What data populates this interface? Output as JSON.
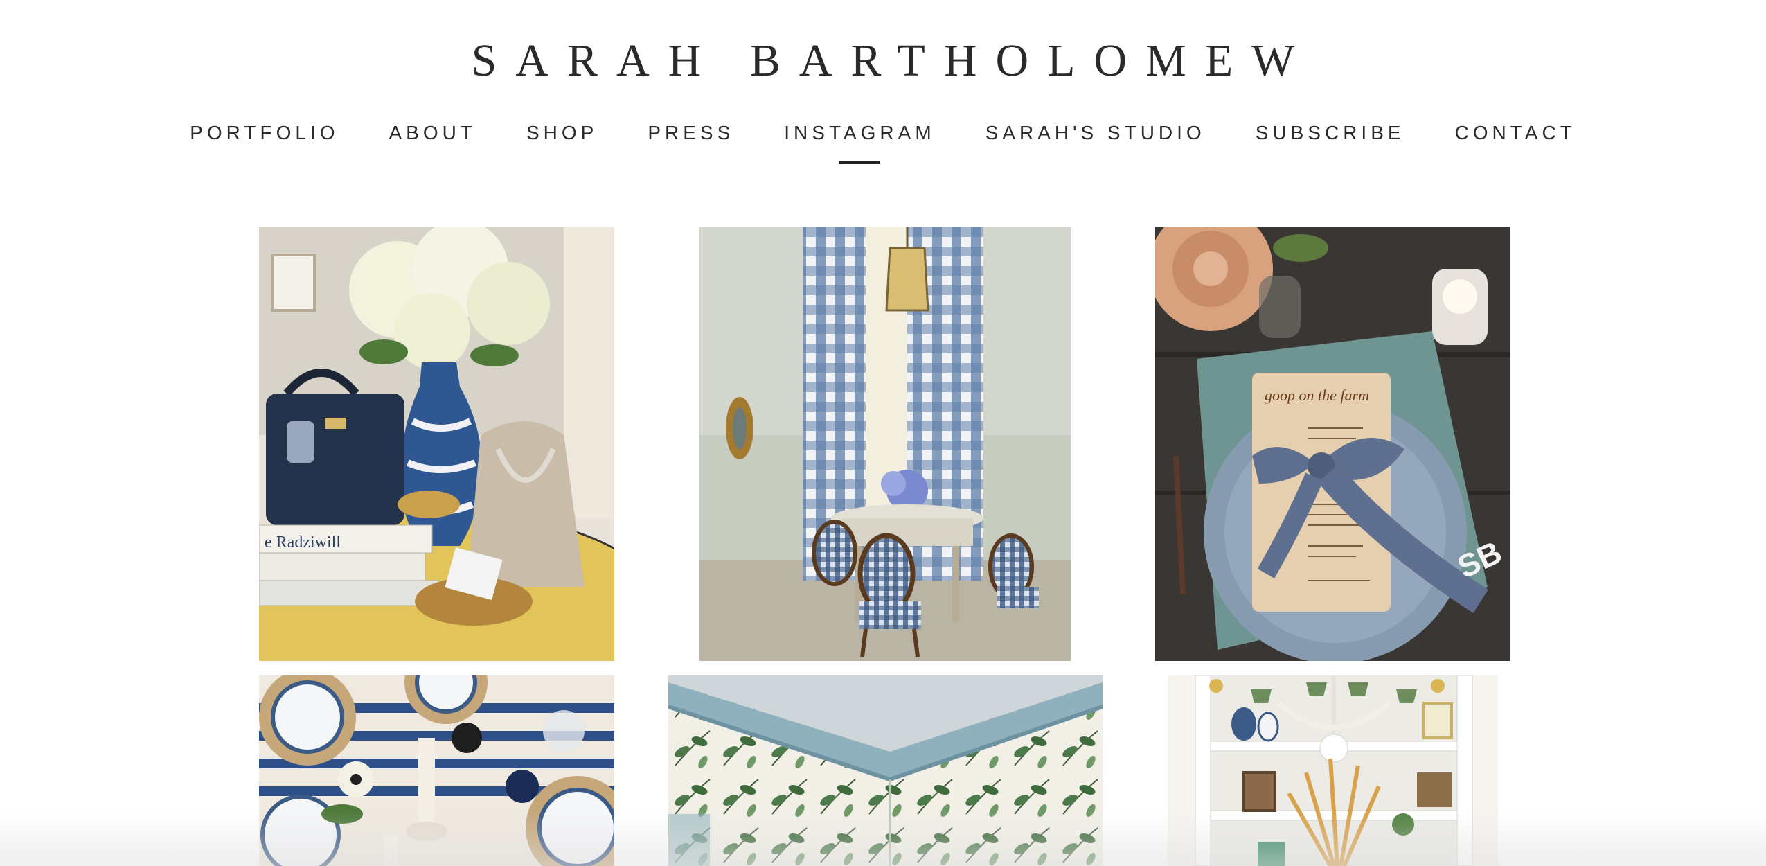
{
  "site": {
    "title": "SARAH BARTHOLOMEW"
  },
  "nav": {
    "items": [
      {
        "label": "PORTFOLIO"
      },
      {
        "label": "ABOUT"
      },
      {
        "label": "SHOP"
      },
      {
        "label": "PRESS"
      },
      {
        "label": "INSTAGRAM",
        "active": true
      },
      {
        "label": "SARAH'S STUDIO"
      },
      {
        "label": "SUBSCRIBE"
      },
      {
        "label": "CONTACT"
      }
    ]
  },
  "gallery": {
    "photos": [
      {
        "name": "hydrangea-vignette-photo",
        "books_text": "e Radziwill"
      },
      {
        "name": "gingham-dining-room-photo"
      },
      {
        "name": "goop-on-the-farm-place-setting-photo",
        "menu_title": "goop on the farm",
        "monogram": "SB"
      },
      {
        "name": "blue-white-tablescape-photo"
      },
      {
        "name": "botanical-wallpaper-ceiling-photo"
      },
      {
        "name": "white-bookshelf-chinoiserie-photo"
      }
    ]
  },
  "colors": {
    "text": "#2a2a2a",
    "background": "#ffffff",
    "accent_blue": "#3b5a86",
    "gold": "#d9b553"
  }
}
